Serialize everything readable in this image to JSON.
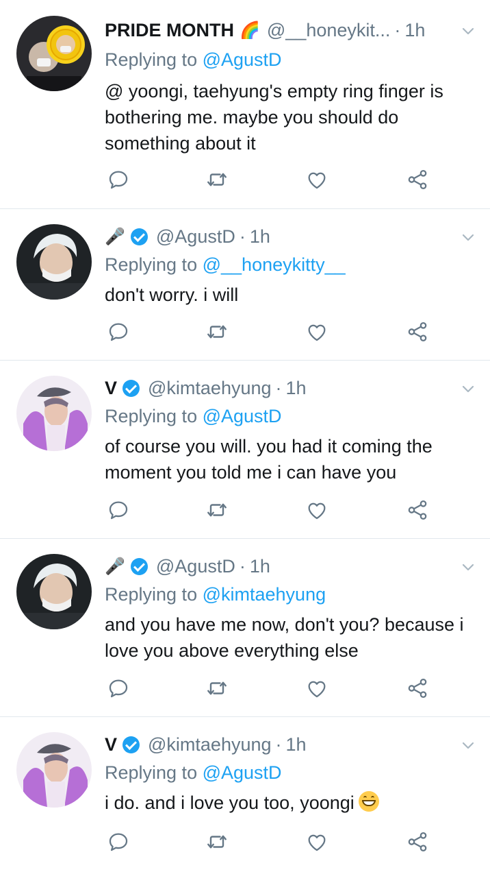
{
  "tweets": [
    {
      "name": "PRIDE MONTH",
      "name_emoji": "🌈",
      "handle": "@__honeykit...",
      "separator": "·",
      "time": "1h",
      "replying_prefix": "Replying to",
      "replying_to": "@AgustD",
      "text": "@ yoongi, taehyung's empty ring finger is bothering me. maybe you should do something about it",
      "verified": false,
      "avatar": "sunflower-hat"
    },
    {
      "name": "🎤",
      "name_emoji": "",
      "handle": "@AgustD",
      "separator": "·",
      "time": "1h",
      "replying_prefix": "Replying to",
      "replying_to": "@__honeykitty__",
      "text": "don't worry. i will",
      "verified": true,
      "avatar": "white-hair-mask"
    },
    {
      "name": "V",
      "name_emoji": "",
      "handle": "@kimtaehyung",
      "separator": "·",
      "time": "1h",
      "replying_prefix": "Replying to",
      "replying_to": "@AgustD",
      "text": "of course you will. you had it coming the moment you told me i can have you",
      "verified": true,
      "avatar": "pastel-selfie"
    },
    {
      "name": "🎤",
      "name_emoji": "",
      "handle": "@AgustD",
      "separator": "·",
      "time": "1h",
      "replying_prefix": "Replying to",
      "replying_to": "@kimtaehyung",
      "text": "and you have me now, don't you? because i love you above everything else",
      "verified": true,
      "avatar": "white-hair-mask"
    },
    {
      "name": "V",
      "name_emoji": "",
      "handle": "@kimtaehyung",
      "separator": "·",
      "time": "1h",
      "replying_prefix": "Replying to",
      "replying_to": "@AgustD",
      "text": "i do. and i love you too, yoongi",
      "verified": true,
      "avatar": "pastel-selfie"
    }
  ],
  "icons": {
    "reply": "reply-icon",
    "retweet": "retweet-icon",
    "like": "heart-icon",
    "share": "share-icon",
    "caret": "chevron-down-icon",
    "verified": "verified-badge-icon",
    "emoji_end": "grinning-face-icon"
  },
  "colors": {
    "link": "#1da1f2",
    "muted": "#657786",
    "text": "#14171a",
    "divider": "#e1e8ed"
  }
}
